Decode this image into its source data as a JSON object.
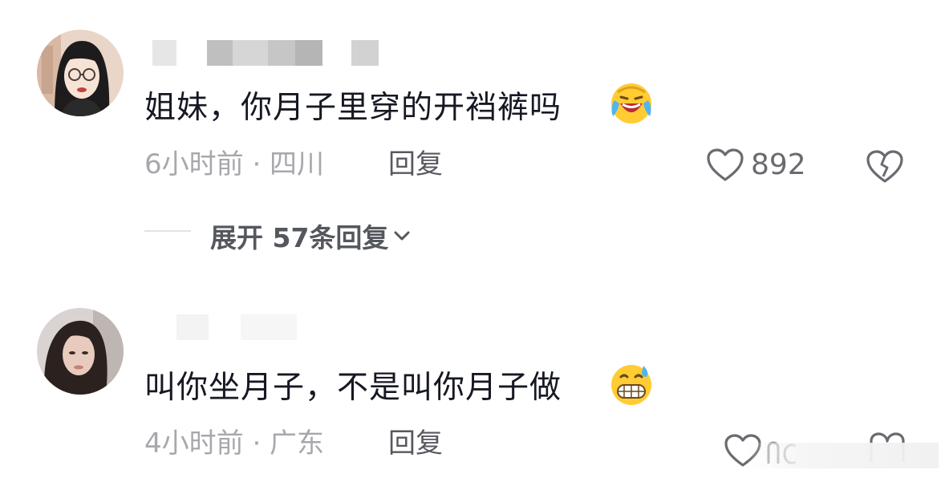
{
  "comments": [
    {
      "username": "",
      "text": "姐妹，你月子里穿的开裆裤吗",
      "emoji_icon": "tears-of-joy-emoji",
      "time": "6小时前",
      "location": "四川",
      "meta": "6小时前 · 四川",
      "reply_label": "回复",
      "like_count": "892",
      "expand_label": "展开 57条回复"
    },
    {
      "username": "",
      "text": "叫你坐月子，不是叫你月子做",
      "emoji_icon": "grimacing-sweat-emoji",
      "time": "4小时前",
      "location": "广东",
      "meta": "4小时前 · 广东",
      "reply_label": "回复"
    }
  ],
  "colors": {
    "text_primary": "#161823",
    "text_secondary": "#a7a8ad",
    "reply": "#57585f",
    "icon": "#6a6b71"
  }
}
